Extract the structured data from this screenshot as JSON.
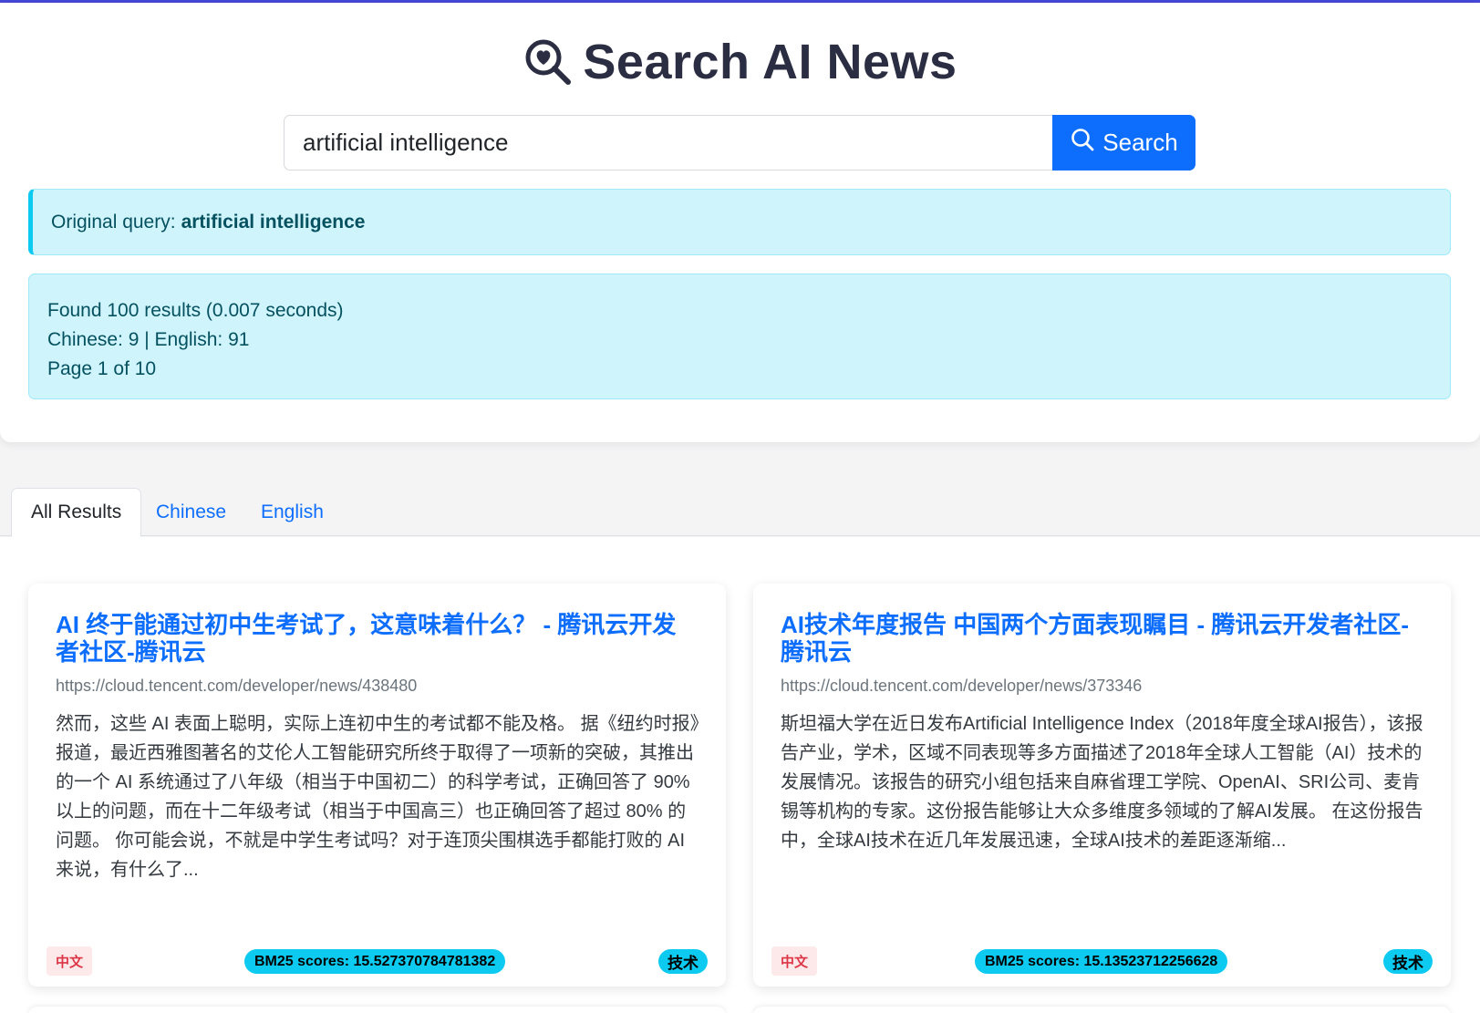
{
  "header": {
    "title": "Search AI News",
    "icon": "search-heart-icon"
  },
  "search": {
    "value": "artificial intelligence",
    "button_label": "Search",
    "button_icon": "search-icon"
  },
  "query_info": {
    "label": "Original query:",
    "query": "artificial intelligence"
  },
  "stats": {
    "found": "Found 100 results (0.007 seconds)",
    "languages": "Chinese: 9 | English: 91",
    "page": "Page 1 of 10"
  },
  "tabs": [
    {
      "label": "All Results",
      "active": true
    },
    {
      "label": "Chinese",
      "active": false
    },
    {
      "label": "English",
      "active": false
    }
  ],
  "results": [
    {
      "title": "AI 终于能通过初中生考试了，这意味着什么？ - 腾讯云开发者社区-腾讯云",
      "url": "https://cloud.tencent.com/developer/news/438480",
      "snippet": "然而，这些 AI 表面上聪明，实际上连初中生的考试都不能及格。 据《纽约时报》报道，最近西雅图著名的艾伦人工智能研究所终于取得了一项新的突破，其推出的一个 AI 系统通过了八年级（相当于中国初二）的科学考试，正确回答了 90% 以上的问题，而在十二年级考试（相当于中国高三）也正确回答了超过 80% 的问题。 你可能会说，不就是中学生考试吗？对于连顶尖围棋选手都能打败的 AI 来说，有什么了...",
      "language": "中文",
      "score": "BM25 scores: 15.527370784781382",
      "category": "技术"
    },
    {
      "title": "AI技术年度报告 中国两个方面表现瞩目 - 腾讯云开发者社区-腾讯云",
      "url": "https://cloud.tencent.com/developer/news/373346",
      "snippet": "斯坦福大学在近日发布Artificial Intelligence Index（2018年度全球AI报告），该报告产业，学术，区域不同表现等多方面描述了2018年全球人工智能（AI）技术的发展情况。该报告的研究小组包括来自麻省理工学院、OpenAI、SRI公司、麦肯锡等机构的专家。这份报告能够让大众多维度多领域的了解AI发展。 在这份报告中，全球AI技术在近几年发展迅速，全球AI技术的差距逐渐缩...",
      "language": "中文",
      "score": "BM25 scores: 15.13523712256628",
      "category": "技术"
    }
  ],
  "colors": {
    "accent": "#0d6efd",
    "info_bg": "#cff4fc",
    "info_text": "#055160",
    "badge_cyan": "#0dcaf0",
    "lang_badge_text": "#dc3545",
    "title_text": "#2b2d42"
  }
}
